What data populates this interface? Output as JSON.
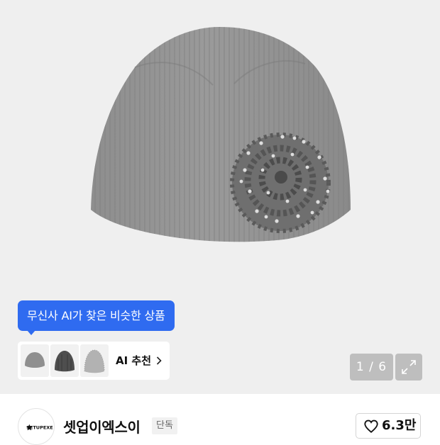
{
  "tooltip": {
    "text": "무신사 AI가 찾은 비슷한 상품"
  },
  "ai_recommend": {
    "label": "AI 추천",
    "thumbnails": [
      {
        "icon": "gray-beanie-thumbnail"
      },
      {
        "icon": "charcoal-beanie-thumbnail"
      },
      {
        "icon": "light-gray-beanie-thumbnail"
      }
    ]
  },
  "gallery": {
    "pager_text": "1 / 6",
    "current": 1,
    "total": 6
  },
  "brand": {
    "name": "셋업이엑스이",
    "badge": "단독",
    "logo_text": "SETUPEXE"
  },
  "like": {
    "count": "6.3만"
  },
  "colors": {
    "accent": "#2f6bf0",
    "image_bg": "#efefef"
  }
}
